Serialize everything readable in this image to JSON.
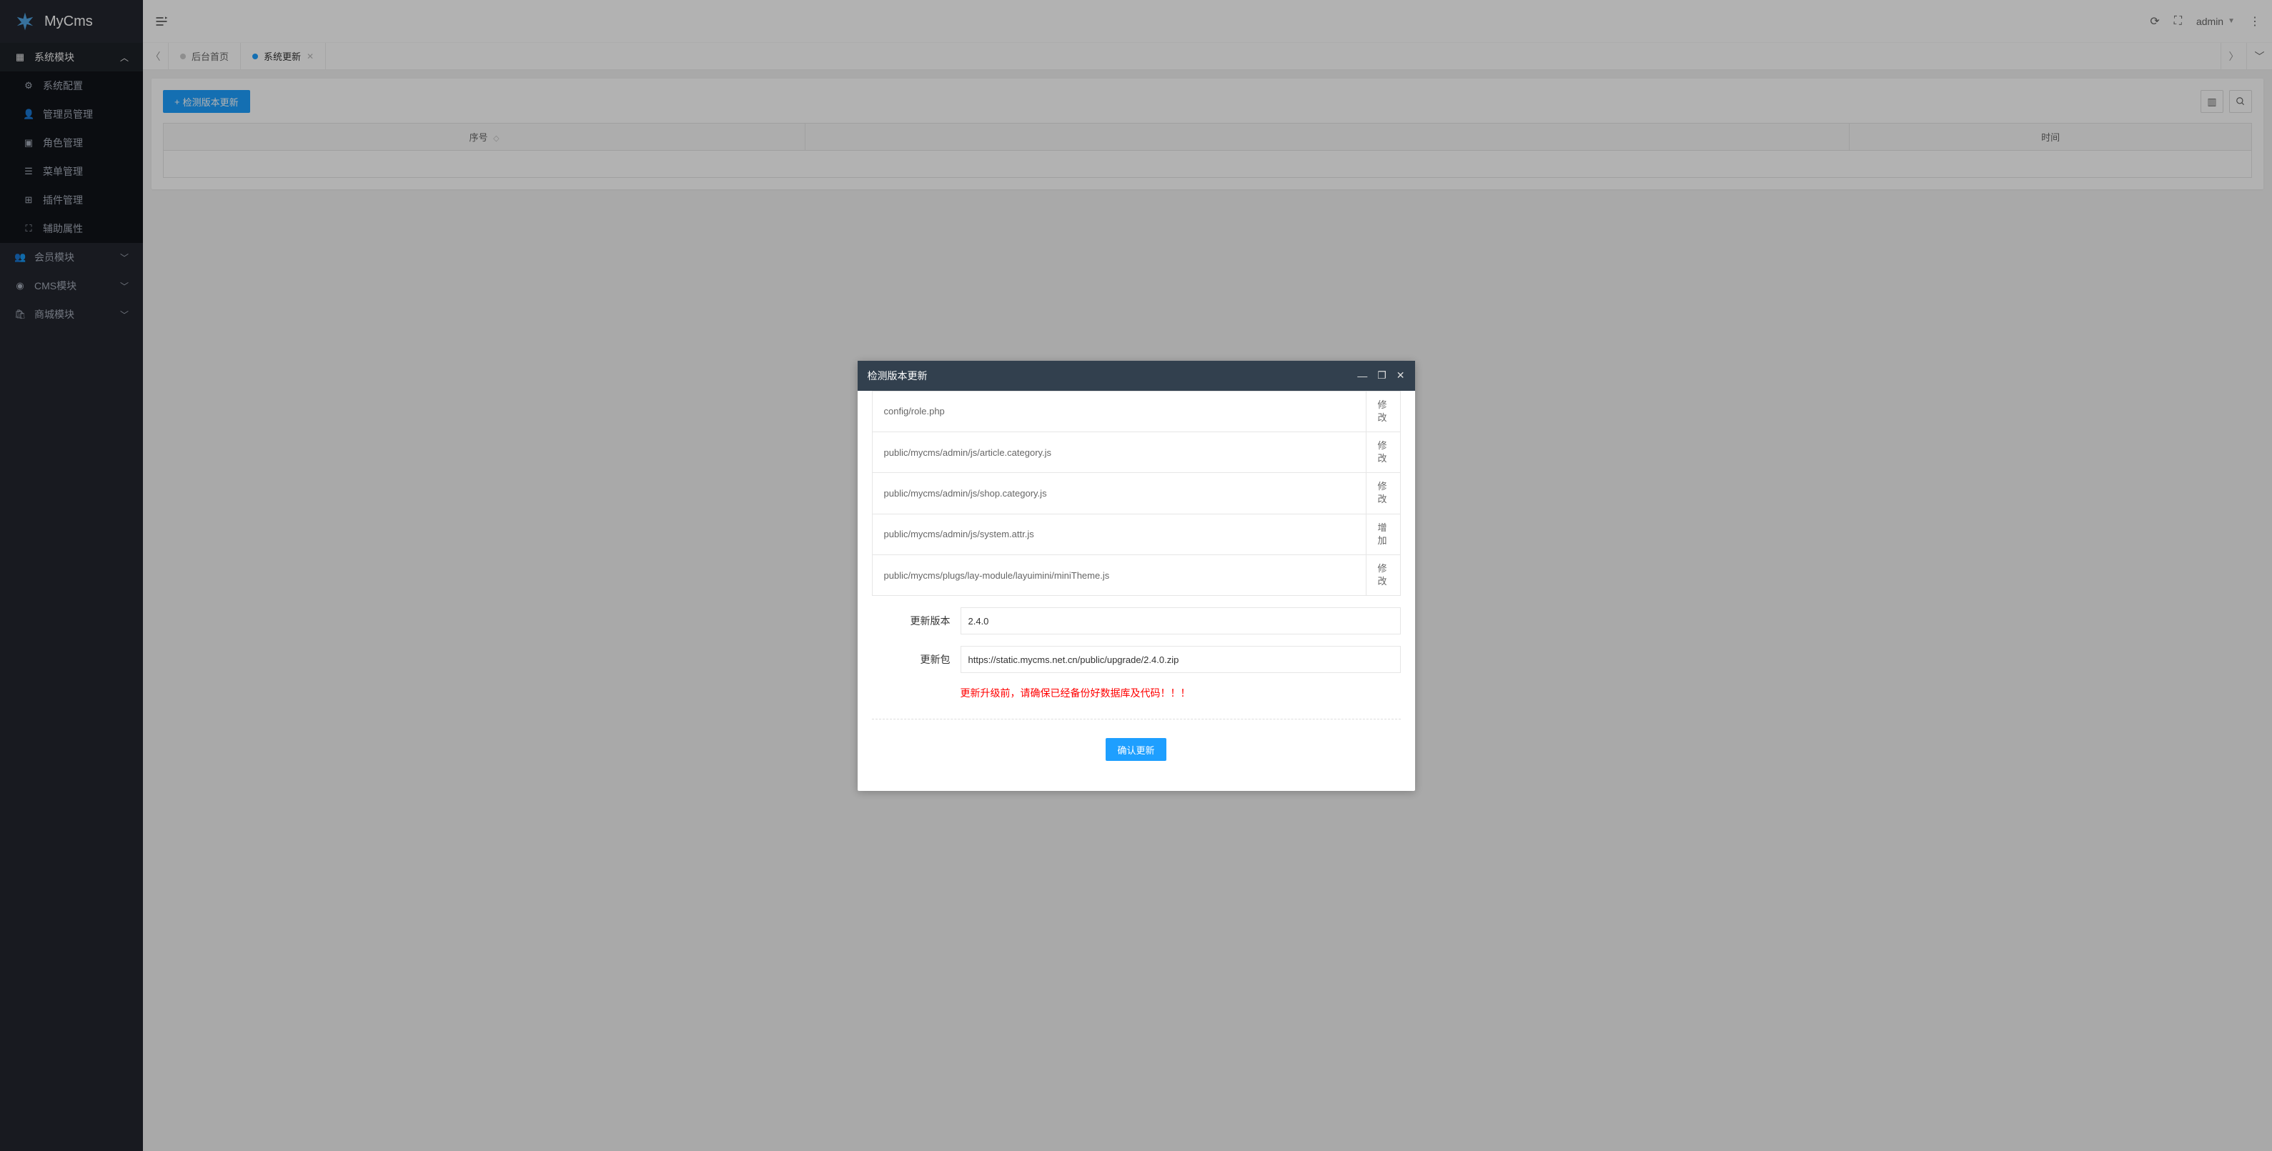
{
  "logo": {
    "text": "MyCms"
  },
  "sidebar": {
    "groups": [
      {
        "label": "系统模块",
        "expanded": true,
        "children": [
          {
            "label": "系统配置",
            "icon": "gear"
          },
          {
            "label": "管理员管理",
            "icon": "user"
          },
          {
            "label": "角色管理",
            "icon": "file"
          },
          {
            "label": "菜单管理",
            "icon": "list"
          },
          {
            "label": "插件管理",
            "icon": "plus-square"
          },
          {
            "label": "辅助属性",
            "icon": "expand"
          }
        ]
      },
      {
        "label": "会员模块",
        "expanded": false,
        "icon": "users"
      },
      {
        "label": "CMS模块",
        "expanded": false,
        "icon": "disc"
      },
      {
        "label": "商城模块",
        "expanded": false,
        "icon": "bag"
      }
    ]
  },
  "topbar": {
    "user": "admin"
  },
  "tabs": [
    {
      "label": "后台首页",
      "active": false,
      "closable": false
    },
    {
      "label": "系统更新",
      "active": true,
      "closable": true
    }
  ],
  "content": {
    "check_update_btn": "检测版本更新",
    "columns": [
      {
        "label": "序号",
        "sortable": true
      },
      {
        "label": "时间",
        "sortable": false
      }
    ]
  },
  "dialog": {
    "title": "检测版本更新",
    "files": [
      {
        "path": "config/role.php",
        "action": "修改"
      },
      {
        "path": "public/mycms/admin/js/article.category.js",
        "action": "修改"
      },
      {
        "path": "public/mycms/admin/js/shop.category.js",
        "action": "修改"
      },
      {
        "path": "public/mycms/admin/js/system.attr.js",
        "action": "增加"
      },
      {
        "path": "public/mycms/plugs/lay-module/layuimini/miniTheme.js",
        "action": "修改"
      }
    ],
    "version_label": "更新版本",
    "version_value": "2.4.0",
    "package_label": "更新包",
    "package_value": "https://static.mycms.net.cn/public/upgrade/2.4.0.zip",
    "warning": "更新升级前，请确保已经备份好数据库及代码！！！",
    "confirm_btn": "确认更新"
  }
}
